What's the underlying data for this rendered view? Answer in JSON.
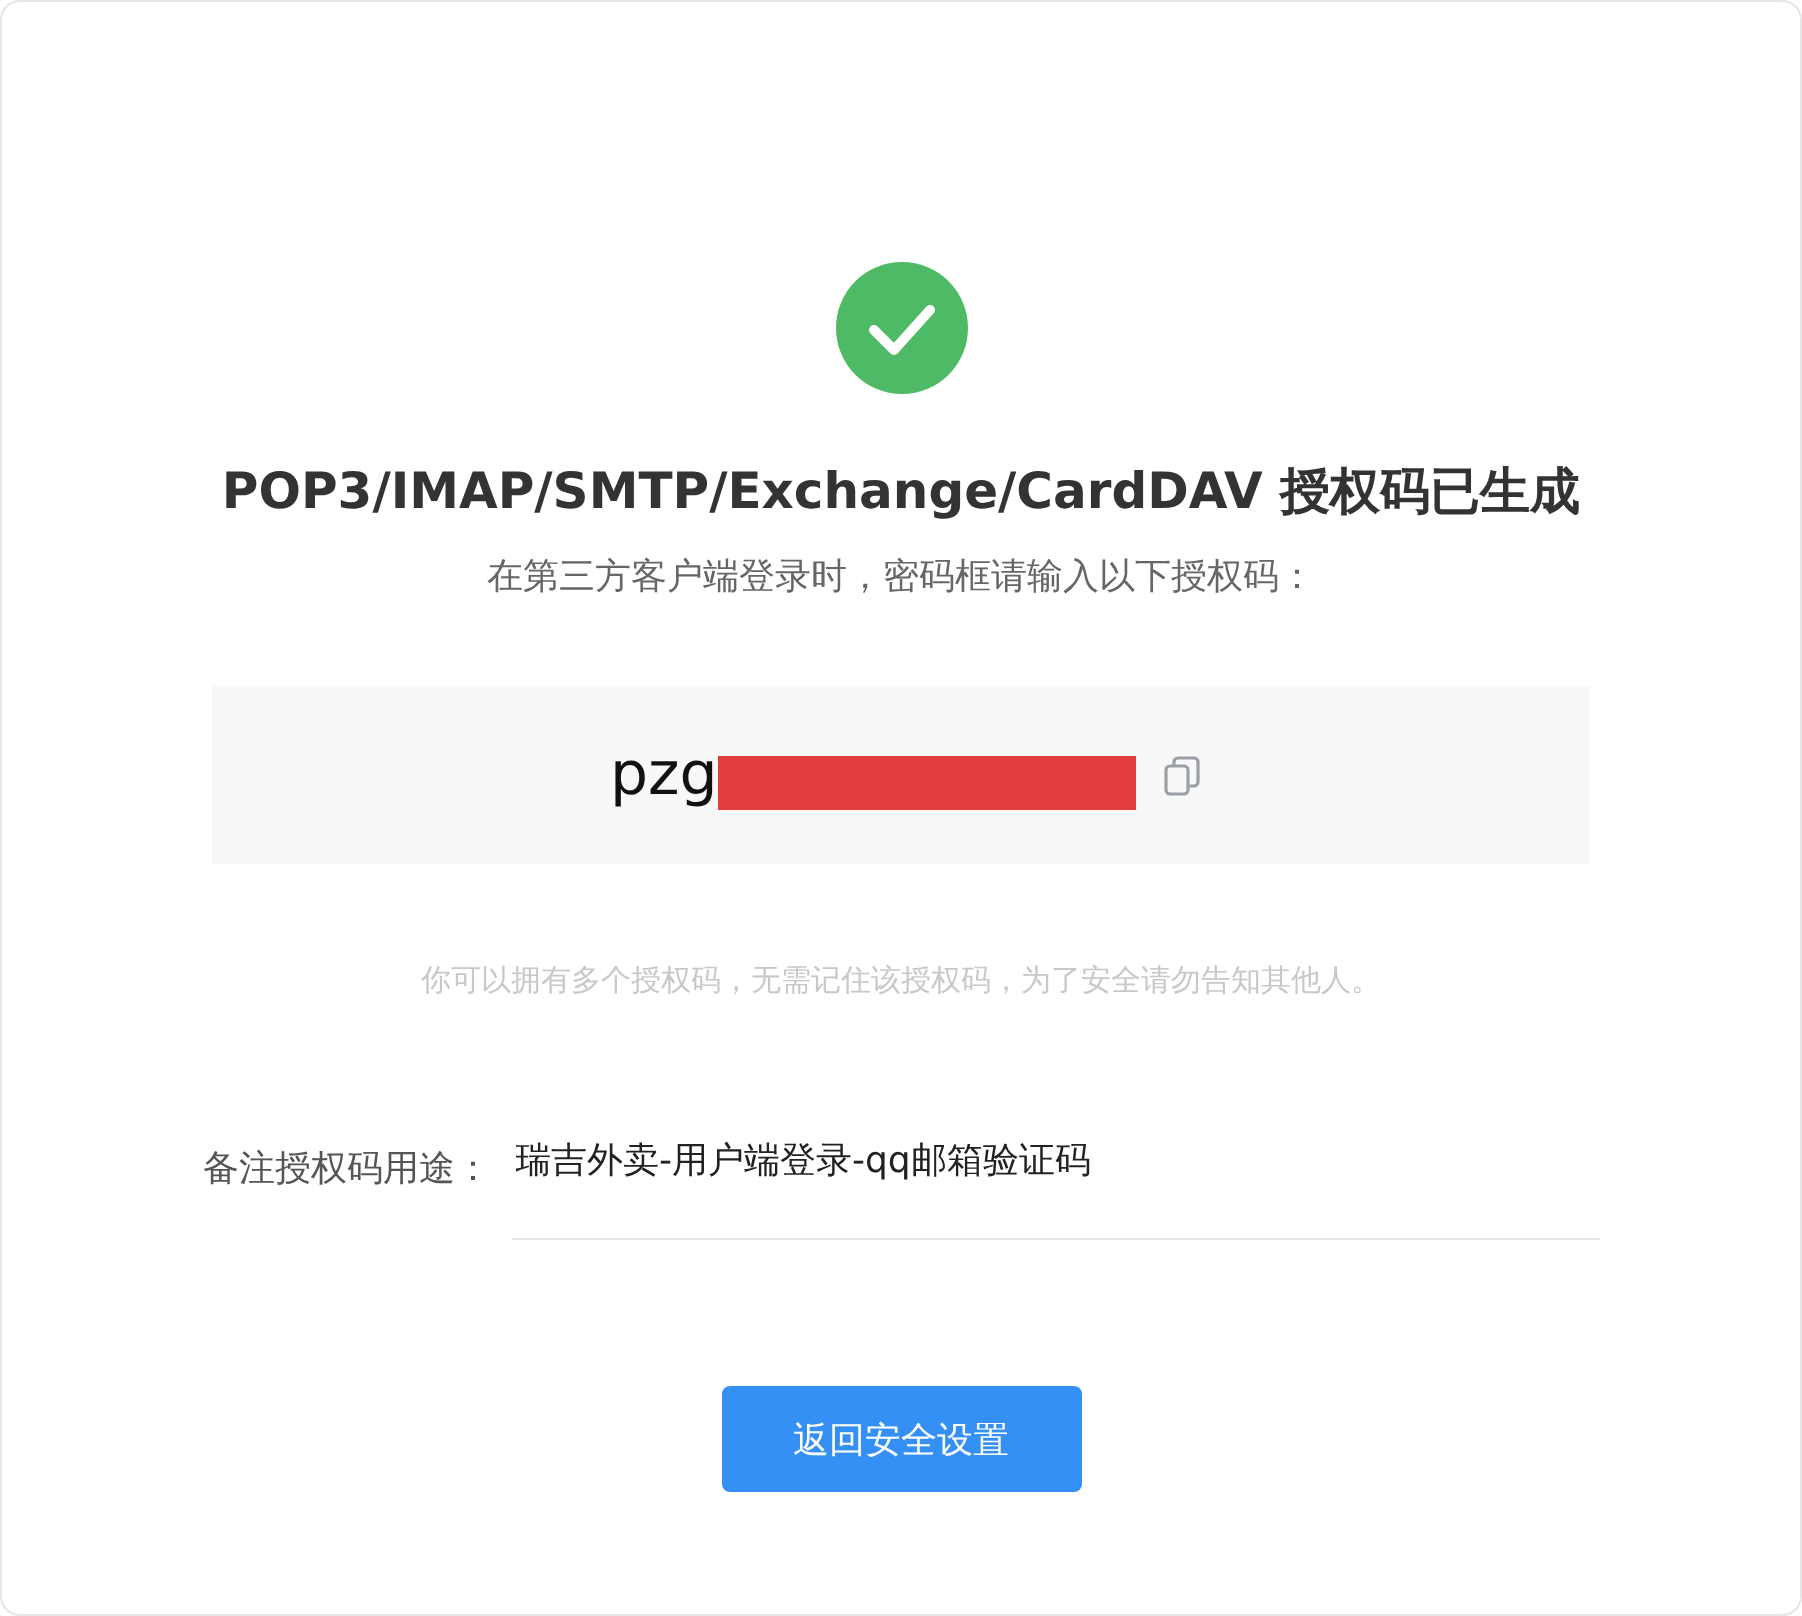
{
  "status": {
    "kind": "success"
  },
  "title": "POP3/IMAP/SMTP/Exchange/CardDAV 授权码已生成",
  "subtitle": "在第三方客户端登录时，密码框请输入以下授权码：",
  "auth_code": {
    "value": "pzg",
    "redacted": true
  },
  "hint": "你可以拥有多个授权码，无需记住该授权码，为了安全请勿告知其他人。",
  "remark": {
    "label": "备注授权码用途：",
    "value": "瑞吉外卖-用户端登录-qq邮箱验证码"
  },
  "button": {
    "label": "返回安全设置"
  }
}
